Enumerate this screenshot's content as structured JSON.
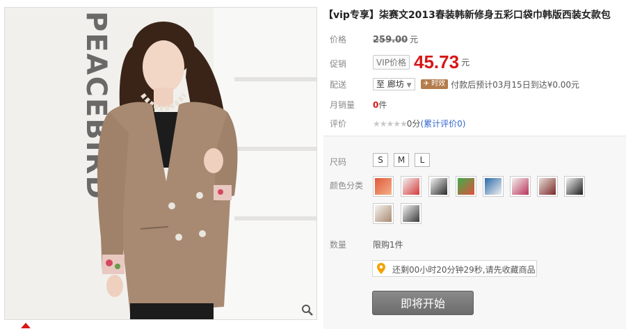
{
  "product": {
    "title": "【vip专享】柒赛文2013春装韩新修身五彩口袋巾韩版西装女款包",
    "image_watermark": "PEACEBIRD"
  },
  "price": {
    "label": "价格",
    "original": "259.00",
    "unit": "元"
  },
  "promo": {
    "label": "促销",
    "tag": "VIP价格",
    "price": "45.73",
    "unit": "元"
  },
  "delivery": {
    "label": "配送",
    "region": "至 廊坊",
    "badge": "时效",
    "text": "付款后预计03月15日到达¥0.00元"
  },
  "monthly_sales": {
    "label": "月销量",
    "count": "0",
    "unit": "件"
  },
  "rating": {
    "label": "评价",
    "stars": "★★★★★",
    "score": "0分",
    "link": "(累计评价0)"
  },
  "size": {
    "label": "尺码",
    "options": [
      "S",
      "M",
      "L"
    ]
  },
  "color": {
    "label": "颜色分类"
  },
  "quantity": {
    "label": "数量",
    "limit": "限购1件"
  },
  "countdown": {
    "text": "还剩00小时20分钟29秒,请先收藏商品"
  },
  "buy": {
    "label": "即将开始"
  }
}
